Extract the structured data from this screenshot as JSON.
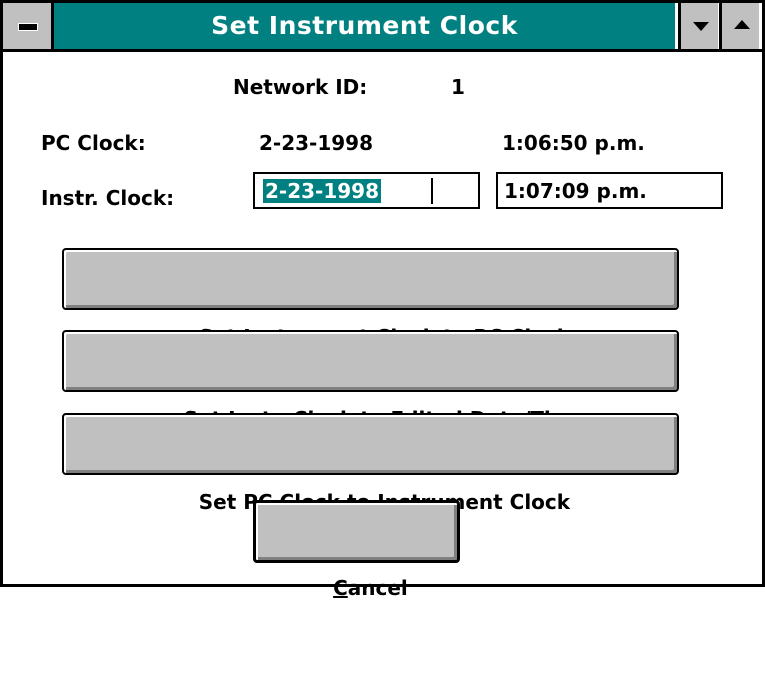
{
  "window": {
    "title": "Set Instrument Clock"
  },
  "network": {
    "label": "Network ID:",
    "value": "1"
  },
  "pc_clock": {
    "label": "PC Clock:",
    "date": "2-23-1998",
    "time": "1:06:50 p.m."
  },
  "instr_clock": {
    "label": "Instr. Clock:",
    "date": "2-23-1998",
    "time": "1:07:09 p.m."
  },
  "buttons": {
    "set_instr_to_pc": {
      "pre": "Set Instrument Clock to ",
      "key": "P",
      "post": "C Clock"
    },
    "set_instr_to_edited": {
      "pre": "Set Instr. Clock to ",
      "key": "E",
      "post": "dited Date/Time"
    },
    "set_pc_to_instr": {
      "pre": "Set PC Clock to ",
      "key": "I",
      "post": "nstrument Clock"
    },
    "cancel": {
      "pre": "",
      "key": "C",
      "post": "ancel"
    }
  },
  "colors": {
    "titlebar": "#008080",
    "button_face": "#c0c0c0",
    "selection": "#008080"
  },
  "icons": {
    "system_menu": "system-menu-icon",
    "minimize": "minimize-arrow-icon",
    "maximize": "maximize-arrow-icon"
  }
}
